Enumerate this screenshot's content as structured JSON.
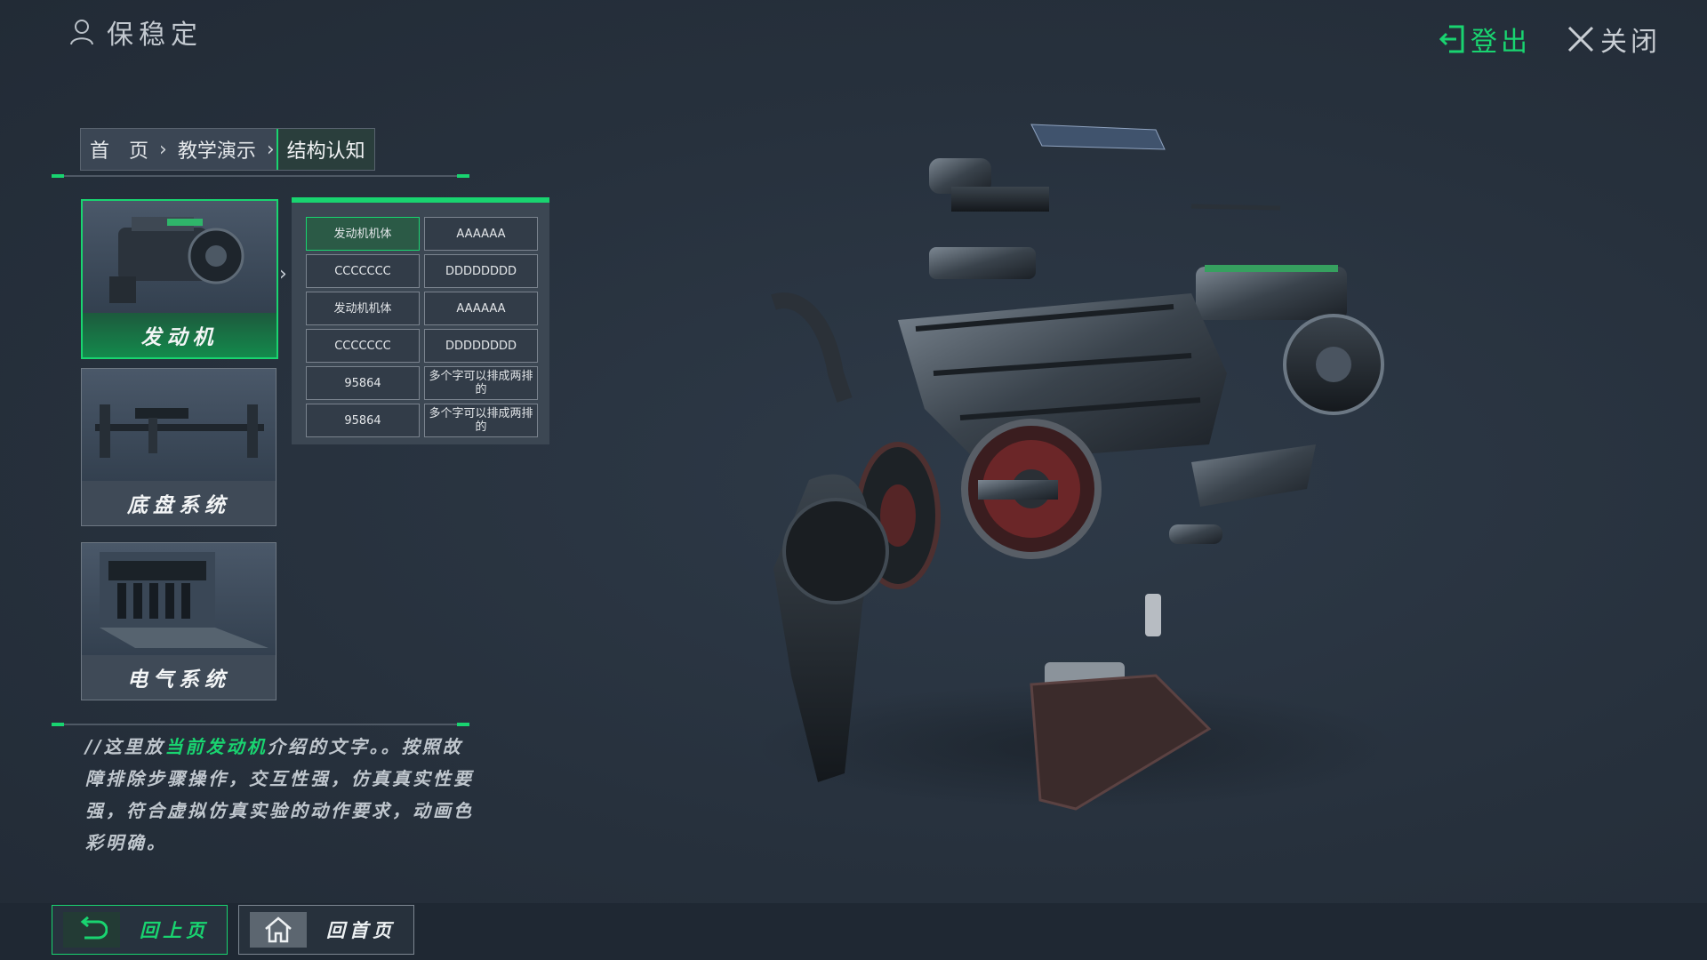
{
  "header": {
    "user_name": "保稳定",
    "logout_label": "登出",
    "close_label": "关闭"
  },
  "breadcrumb": {
    "items": [
      "首　页",
      "教学演示"
    ],
    "current": "结构认知"
  },
  "systems": [
    {
      "label": "发动机",
      "active": true
    },
    {
      "label": "底盘系统",
      "active": false
    },
    {
      "label": "电气系统",
      "active": false
    }
  ],
  "parts_grid": [
    [
      "发动机机体",
      "AAAAAA"
    ],
    [
      "CCCCCCC",
      "DDDDDDDD"
    ],
    [
      "发动机机体",
      "AAAAAA"
    ],
    [
      "CCCCCCC",
      "DDDDDDDD"
    ],
    [
      "95864",
      "多个字可以排成两排的"
    ],
    [
      "95864",
      "多个字可以排成两排的"
    ]
  ],
  "description": {
    "prefix": "//这里放",
    "highlight": "当前发动机",
    "suffix": "介绍的文字。。按照故障排除步骤操作，交互性强，仿真真实性要强，符合虚拟仿真实验的动作要求，动画色彩明确。"
  },
  "bottom": {
    "back_label": "回上页",
    "home_label": "回首页"
  },
  "colors": {
    "accent": "#19d470",
    "background": "#27313d"
  },
  "icons": [
    "user-icon",
    "logout-icon",
    "close-icon",
    "chevron-right-icon",
    "back-arrow-icon",
    "home-icon"
  ]
}
